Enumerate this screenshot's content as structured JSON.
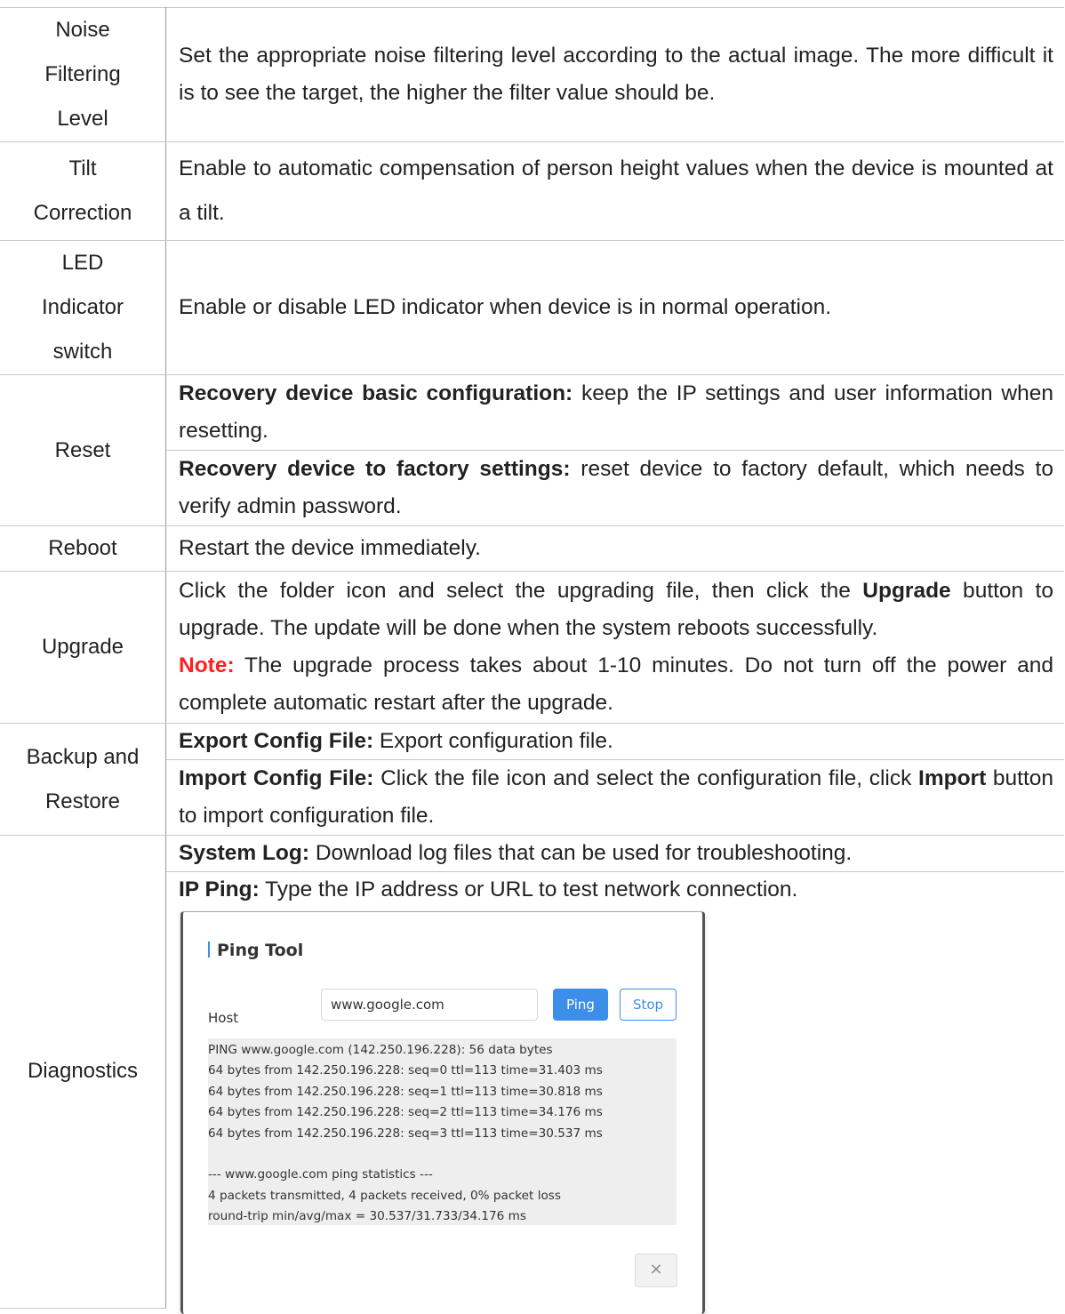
{
  "rows": {
    "noise": {
      "param": [
        "Noise",
        "Filtering",
        "Level"
      ],
      "desc": "Set the appropriate noise filtering level according to the actual image. The more difficult it is to see the target, the higher the filter value should be."
    },
    "tilt": {
      "param": [
        "Tilt",
        "Correction"
      ],
      "desc": "Enable to automatic compensation of person height values when the device is mounted at a tilt."
    },
    "led": {
      "param": [
        "LED",
        "Indicator",
        "switch"
      ],
      "desc": "Enable or disable LED indicator when device is in normal operation."
    },
    "reset": {
      "param": "Reset",
      "basic_label": "Recovery device basic configuration:",
      "basic_text": " keep the IP settings and user information when resetting.",
      "factory_label": "Recovery device to factory settings:",
      "factory_text": " reset device to factory default, which needs to verify admin password."
    },
    "reboot": {
      "param": "Reboot",
      "desc": "Restart the device immediately."
    },
    "upgrade": {
      "param": "Upgrade",
      "text1": "Click the folder icon and select the upgrading file, then click the ",
      "upgrade_bold": "Upgrade",
      "text2": " button to upgrade. The update will be done when the system reboots successfully.",
      "note_label": "Note:",
      "note_text": " The upgrade process takes about 1-10 minutes. Do not turn off the power and complete automatic restart after the upgrade."
    },
    "backup": {
      "param": [
        "Backup and",
        "Restore"
      ],
      "export_label": "Export Config File:",
      "export_text": " Export configuration file.",
      "import_label": "Import Config File:",
      "import_text1": " Click the file icon and select the configuration file, click ",
      "import_bold": "Import",
      "import_text2": " button to import configuration file."
    },
    "diagnostics": {
      "param": "Diagnostics",
      "syslog_label": "System Log:",
      "syslog_text": " Download log files that can be used for troubleshooting.",
      "ipping_label": "IP Ping:",
      "ipping_text": " Type the IP address or URL to test network connection."
    }
  },
  "ping_tool": {
    "title": "Ping Tool",
    "host_label": "Host",
    "host_value": "www.google.com",
    "ping_label": "Ping",
    "stop_label": "Stop",
    "close_label": "×",
    "output": [
      "PING www.google.com (142.250.196.228): 56 data bytes",
      "64 bytes from 142.250.196.228: seq=0 ttl=113 time=31.403 ms",
      "64 bytes from 142.250.196.228: seq=1 ttl=113 time=30.818 ms",
      "64 bytes from 142.250.196.228: seq=2 ttl=113 time=34.176 ms",
      "64 bytes from 142.250.196.228: seq=3 ttl=113 time=30.537 ms",
      "",
      "--- www.google.com ping statistics ---",
      "4 packets transmitted, 4 packets received, 0% packet loss",
      "round-trip min/avg/max = 30.537/31.733/34.176 ms"
    ]
  }
}
